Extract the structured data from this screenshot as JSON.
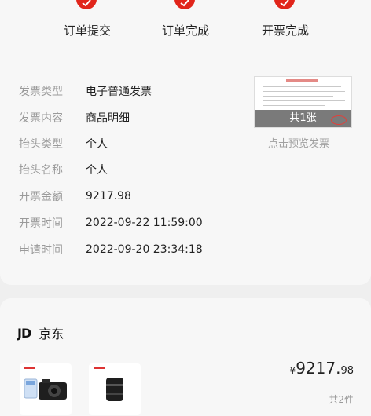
{
  "steps": [
    {
      "label": "订单提交"
    },
    {
      "label": "订单完成"
    },
    {
      "label": "开票完成"
    }
  ],
  "invoice": {
    "fields": [
      {
        "label": "发票类型",
        "value": "电子普通发票"
      },
      {
        "label": "发票内容",
        "value": "商品明细"
      },
      {
        "label": "抬头类型",
        "value": "个人"
      },
      {
        "label": "抬头名称",
        "value": "个人"
      },
      {
        "label": "开票金额",
        "value": "9217.98"
      },
      {
        "label": "开票时间",
        "value": "2022-09-22 11:59:00"
      },
      {
        "label": "申请时间",
        "value": "2022-09-20 23:34:18"
      }
    ],
    "thumbnail_overlay": "共1张",
    "preview_label": "点击预览发票"
  },
  "order": {
    "shop_logo": "JD",
    "shop_name": "京东",
    "price_symbol": "¥",
    "price_main": "9217.",
    "price_cents": "98",
    "item_count": "共2件"
  },
  "colors": {
    "accent": "#e1251b",
    "label_gray": "#9a9a9a",
    "card_bg": "#f7f7f7",
    "page_bg": "#efefef"
  }
}
